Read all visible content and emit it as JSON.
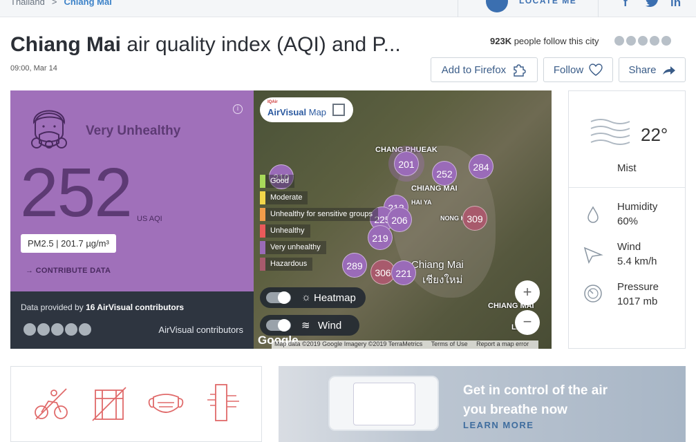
{
  "breadcrumb": {
    "parent": "Thailand",
    "separator": ">",
    "current": "Chiang Mai"
  },
  "locate": {
    "label": "LOCATE ME"
  },
  "page": {
    "title_bold": "Chiang Mai",
    "title_rest": " air quality index (AQI) and P...",
    "date": "09:00, Mar 14"
  },
  "followers": {
    "count": "923K",
    "text": " people follow this city"
  },
  "actions": {
    "add_to_firefox": "Add to Firefox",
    "follow": "Follow",
    "share": "Share"
  },
  "aqi_panel": {
    "status": "Very Unhealthy",
    "value": "252",
    "unit": "US AQI",
    "pm": "PM2.5 | 201.7 µg/m³",
    "contribute": "CONTRIBUTE DATA",
    "provided_pre": "Data provided by ",
    "provided_count": "16 AirVisual contributors",
    "contributors_label": "AirVisual contributors",
    "color": "#a070ba"
  },
  "map": {
    "brand_small": "IQAir",
    "brand_air": "AirVisual",
    "brand_map": " Map",
    "legend": [
      {
        "label": "Good",
        "color": "#a8d95a"
      },
      {
        "label": "Moderate",
        "color": "#f2d64a"
      },
      {
        "label": "Unhealthy for sensitive groups",
        "color": "#f29c4a"
      },
      {
        "label": "Unhealthy",
        "color": "#ea5a5a"
      },
      {
        "label": "Very unhealthy",
        "color": "#9a6bb8"
      },
      {
        "label": "Hazardous",
        "color": "#a85a6c"
      }
    ],
    "markers": [
      "210",
      "201",
      "252",
      "284",
      "212",
      "225",
      "206",
      "309",
      "219",
      "289",
      "306",
      "221"
    ],
    "places": [
      "CHANG PHUEAK",
      "CHIANG MAI",
      "HAI YA",
      "NONG HOI",
      "Chiang Mai",
      "เชียงใหม่",
      "CHIANG MAI",
      "LAMP"
    ],
    "heatmap_label": "Heatmap",
    "wind_label": "Wind",
    "google": "Google",
    "attribution": [
      "Map data ©2019 Google Imagery ©2019 TerraMetrics",
      "Terms of Use",
      "Report a map error"
    ],
    "zoom_in": "+",
    "zoom_out": "−"
  },
  "weather": {
    "temp": "22°",
    "condition": "Mist",
    "humidity_label": "Humidity",
    "humidity_value": "60%",
    "wind_label": "Wind",
    "wind_value": "5.4 km/h",
    "pressure_label": "Pressure",
    "pressure_value": "1017 mb"
  },
  "ad": {
    "headline_1": "Get in control of the air",
    "headline_2": "you breathe now",
    "cta": "LEARN MORE"
  }
}
